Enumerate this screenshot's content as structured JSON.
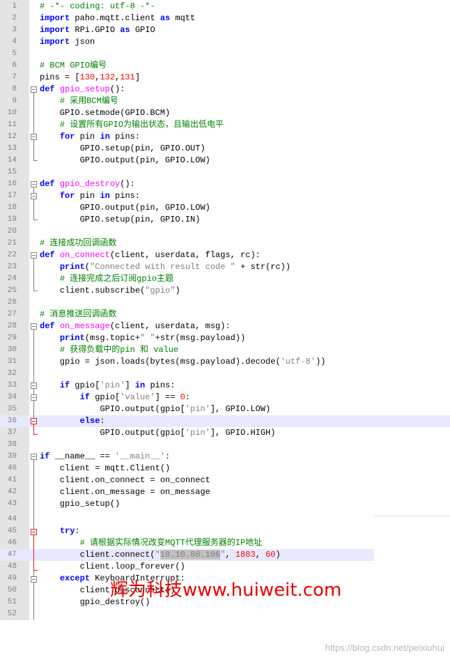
{
  "editor": {
    "lines": [
      {
        "n": "1",
        "seg": [
          {
            "c": "cm",
            "t": "# -*- coding: utf-8 -*-"
          }
        ]
      },
      {
        "n": "2",
        "seg": [
          {
            "c": "kw",
            "t": "import"
          },
          {
            "c": "",
            "t": " paho.mqtt.client "
          },
          {
            "c": "kw",
            "t": "as"
          },
          {
            "c": "",
            "t": " mqtt"
          }
        ]
      },
      {
        "n": "3",
        "seg": [
          {
            "c": "kw",
            "t": "import"
          },
          {
            "c": "",
            "t": " RPi.GPIO "
          },
          {
            "c": "kw",
            "t": "as"
          },
          {
            "c": "",
            "t": " GPIO"
          }
        ]
      },
      {
        "n": "4",
        "seg": [
          {
            "c": "kw",
            "t": "import"
          },
          {
            "c": "",
            "t": " json"
          }
        ]
      },
      {
        "n": "5",
        "seg": []
      },
      {
        "n": "6",
        "seg": [
          {
            "c": "cm",
            "t": "# BCM GPIO编号"
          }
        ]
      },
      {
        "n": "7",
        "seg": [
          {
            "c": "",
            "t": "pins = ["
          },
          {
            "c": "nm",
            "t": "130"
          },
          {
            "c": "",
            "t": ","
          },
          {
            "c": "nm",
            "t": "132"
          },
          {
            "c": "",
            "t": ","
          },
          {
            "c": "nm",
            "t": "131"
          },
          {
            "c": "",
            "t": "]"
          }
        ]
      },
      {
        "n": "8",
        "seg": [
          {
            "c": "kw",
            "t": "def"
          },
          {
            "c": "",
            "t": " "
          },
          {
            "c": "fn",
            "t": "gpio_setup"
          },
          {
            "c": "",
            "t": "():"
          }
        ]
      },
      {
        "n": "9",
        "seg": [
          {
            "c": "",
            "t": "    "
          },
          {
            "c": "cm",
            "t": "# 采用BCM编号"
          }
        ]
      },
      {
        "n": "10",
        "seg": [
          {
            "c": "",
            "t": "    GPIO.setmode(GPIO.BCM)"
          }
        ]
      },
      {
        "n": "11",
        "seg": [
          {
            "c": "",
            "t": "    "
          },
          {
            "c": "cm",
            "t": "# 设置所有GPIO为输出状态，且输出低电平"
          }
        ]
      },
      {
        "n": "12",
        "seg": [
          {
            "c": "",
            "t": "    "
          },
          {
            "c": "kw",
            "t": "for"
          },
          {
            "c": "",
            "t": " pin "
          },
          {
            "c": "kw",
            "t": "in"
          },
          {
            "c": "",
            "t": " pins:"
          }
        ]
      },
      {
        "n": "13",
        "seg": [
          {
            "c": "",
            "t": "        GPIO.setup(pin, GPIO.OUT)"
          }
        ]
      },
      {
        "n": "14",
        "seg": [
          {
            "c": "",
            "t": "        GPIO.output(pin, GPIO.LOW)"
          }
        ]
      },
      {
        "n": "15",
        "seg": []
      },
      {
        "n": "16",
        "seg": [
          {
            "c": "kw",
            "t": "def"
          },
          {
            "c": "",
            "t": " "
          },
          {
            "c": "fn",
            "t": "gpio_destroy"
          },
          {
            "c": "",
            "t": "():"
          }
        ]
      },
      {
        "n": "17",
        "seg": [
          {
            "c": "",
            "t": "    "
          },
          {
            "c": "kw",
            "t": "for"
          },
          {
            "c": "",
            "t": " pin "
          },
          {
            "c": "kw",
            "t": "in"
          },
          {
            "c": "",
            "t": " pins:"
          }
        ]
      },
      {
        "n": "18",
        "seg": [
          {
            "c": "",
            "t": "        GPIO.output(pin, GPIO.LOW)"
          }
        ]
      },
      {
        "n": "19",
        "seg": [
          {
            "c": "",
            "t": "        GPIO.setup(pin, GPIO.IN)"
          }
        ]
      },
      {
        "n": "20",
        "seg": []
      },
      {
        "n": "21",
        "seg": [
          {
            "c": "cm",
            "t": "# 连接成功回调函数"
          }
        ]
      },
      {
        "n": "22",
        "seg": [
          {
            "c": "kw",
            "t": "def"
          },
          {
            "c": "",
            "t": " "
          },
          {
            "c": "fn",
            "t": "on_connect"
          },
          {
            "c": "",
            "t": "(client, userdata, flags, rc):"
          }
        ]
      },
      {
        "n": "23",
        "seg": [
          {
            "c": "",
            "t": "    "
          },
          {
            "c": "kw",
            "t": "print"
          },
          {
            "c": "",
            "t": "("
          },
          {
            "c": "st",
            "t": "\"Connected with result code \""
          },
          {
            "c": "",
            "t": " + str(rc))"
          }
        ]
      },
      {
        "n": "24",
        "seg": [
          {
            "c": "",
            "t": "    "
          },
          {
            "c": "cm",
            "t": "# 连接完成之后订阅gpio主题"
          }
        ]
      },
      {
        "n": "25",
        "seg": [
          {
            "c": "",
            "t": "    client.subscribe("
          },
          {
            "c": "st",
            "t": "\"gpio\""
          },
          {
            "c": "",
            "t": ")"
          }
        ]
      },
      {
        "n": "26",
        "seg": []
      },
      {
        "n": "27",
        "seg": [
          {
            "c": "cm",
            "t": "# 消息推送回调函数"
          }
        ]
      },
      {
        "n": "28",
        "seg": [
          {
            "c": "kw",
            "t": "def"
          },
          {
            "c": "",
            "t": " "
          },
          {
            "c": "fn",
            "t": "on_message"
          },
          {
            "c": "",
            "t": "(client, userdata, msg):"
          }
        ]
      },
      {
        "n": "29",
        "seg": [
          {
            "c": "",
            "t": "    "
          },
          {
            "c": "kw",
            "t": "print"
          },
          {
            "c": "",
            "t": "(msg.topic+"
          },
          {
            "c": "st",
            "t": "\" \""
          },
          {
            "c": "",
            "t": "+str(msg.payload))"
          }
        ]
      },
      {
        "n": "30",
        "seg": [
          {
            "c": "",
            "t": "    "
          },
          {
            "c": "cm",
            "t": "# 获得负载中的pin 和 value"
          }
        ]
      },
      {
        "n": "31",
        "seg": [
          {
            "c": "",
            "t": "    gpio = json.loads(bytes(msg.payload).decode("
          },
          {
            "c": "st",
            "t": "'utf-8'"
          },
          {
            "c": "",
            "t": "))"
          }
        ]
      },
      {
        "n": "32",
        "seg": []
      },
      {
        "n": "33",
        "seg": [
          {
            "c": "",
            "t": "    "
          },
          {
            "c": "kw",
            "t": "if"
          },
          {
            "c": "",
            "t": " gpio["
          },
          {
            "c": "st",
            "t": "'pin'"
          },
          {
            "c": "",
            "t": "] "
          },
          {
            "c": "kw",
            "t": "in"
          },
          {
            "c": "",
            "t": " pins:"
          }
        ]
      },
      {
        "n": "34",
        "seg": [
          {
            "c": "",
            "t": "        "
          },
          {
            "c": "kw",
            "t": "if"
          },
          {
            "c": "",
            "t": " gpio["
          },
          {
            "c": "st",
            "t": "'value'"
          },
          {
            "c": "",
            "t": "] == "
          },
          {
            "c": "nm",
            "t": "0"
          },
          {
            "c": "",
            "t": ":"
          }
        ]
      },
      {
        "n": "35",
        "seg": [
          {
            "c": "",
            "t": "            GPIO.output(gpio["
          },
          {
            "c": "st",
            "t": "'pin'"
          },
          {
            "c": "",
            "t": "], GPIO.LOW)"
          }
        ]
      },
      {
        "n": "36",
        "seg": [
          {
            "c": "",
            "t": "        "
          },
          {
            "c": "kw",
            "t": "else"
          },
          {
            "c": "",
            "t": ":"
          }
        ]
      },
      {
        "n": "37",
        "seg": [
          {
            "c": "",
            "t": "            GPIO.output(gpio["
          },
          {
            "c": "st",
            "t": "'pin'"
          },
          {
            "c": "",
            "t": "], GPIO.HIGH)"
          }
        ]
      },
      {
        "n": "38",
        "seg": []
      },
      {
        "n": "39",
        "seg": [
          {
            "c": "kw",
            "t": "if"
          },
          {
            "c": "",
            "t": " __name__ == "
          },
          {
            "c": "st",
            "t": "'__main__'"
          },
          {
            "c": "",
            "t": ":"
          }
        ]
      },
      {
        "n": "40",
        "seg": [
          {
            "c": "",
            "t": "    client = mqtt.Client()"
          }
        ]
      },
      {
        "n": "41",
        "seg": [
          {
            "c": "",
            "t": "    client.on_connect = on_connect"
          }
        ]
      },
      {
        "n": "42",
        "seg": [
          {
            "c": "",
            "t": "    client.on_message = on_message"
          }
        ]
      },
      {
        "n": "43",
        "seg": [
          {
            "c": "",
            "t": "    gpio_setup()"
          }
        ]
      },
      {
        "n": "44",
        "seg": []
      },
      {
        "n": "45",
        "seg": [
          {
            "c": "",
            "t": "    "
          },
          {
            "c": "kw",
            "t": "try"
          },
          {
            "c": "",
            "t": ":"
          }
        ]
      },
      {
        "n": "46",
        "seg": [
          {
            "c": "",
            "t": "        "
          },
          {
            "c": "cm",
            "t": "# 请根据实际情况改变MQTT代理服务器的IP地址"
          }
        ]
      },
      {
        "n": "47",
        "seg": [
          {
            "c": "",
            "t": "        client.connect("
          },
          {
            "c": "st",
            "t": "\""
          },
          {
            "c": "sel st",
            "t": "10.10.80.106"
          },
          {
            "c": "st",
            "t": "\""
          },
          {
            "c": "",
            "t": ", "
          },
          {
            "c": "nm",
            "t": "1883"
          },
          {
            "c": "",
            "t": ", "
          },
          {
            "c": "nm",
            "t": "60"
          },
          {
            "c": "",
            "t": ")"
          }
        ]
      },
      {
        "n": "48",
        "seg": [
          {
            "c": "",
            "t": "        client.loop_forever()"
          }
        ]
      },
      {
        "n": "49",
        "seg": [
          {
            "c": "",
            "t": "    "
          },
          {
            "c": "kw",
            "t": "except"
          },
          {
            "c": "",
            "t": " KeyboardInterrupt:"
          }
        ]
      },
      {
        "n": "50",
        "seg": [
          {
            "c": "",
            "t": "        client.disconnect()"
          }
        ]
      },
      {
        "n": "51",
        "seg": [
          {
            "c": "",
            "t": "        gpio_destroy()"
          }
        ]
      },
      {
        "n": "52",
        "seg": []
      }
    ]
  },
  "watermark_cn": "辉为科技www.huiweit.com",
  "watermark_csdn": "https://blog.csdn.net/peixiuhui"
}
